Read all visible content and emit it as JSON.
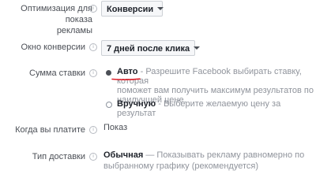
{
  "ad_delivery": {
    "label": "Оптимизация для показа рекламы",
    "label_line1": "Оптимизация для показа",
    "label_line2": "рекламы",
    "value": "Конверсии"
  },
  "conversion_window": {
    "label": "Окно конверсии",
    "value": "7 дней после клика"
  },
  "bid_amount": {
    "label": "Сумма ставки",
    "auto": {
      "label": "Авто",
      "description": "- Разрешите Facebook выбирать ставку, которая поможет вам получить максимум результатов по наилучшей цене.",
      "line1": "- Разрешите Facebook выбирать ставку, которая",
      "line2": "поможет вам получить максимум результатов по",
      "line3": "наилучшей цене.",
      "selected": true
    },
    "manual": {
      "label": "Вручную",
      "description": "- Выберите желаемую цену за результат",
      "selected": false
    }
  },
  "when_charged": {
    "label": "Когда вы платите",
    "value": "Показ"
  },
  "delivery_type": {
    "label": "Тип доставки",
    "value": "Обычная",
    "description": "— Показывать рекламу равномерно по выбранному графику (рекомендуется)",
    "line1": "— Показывать рекламу равномерно по",
    "line2": "выбранному графику (рекомендуется)"
  },
  "colors": {
    "annotation_underline": "#e0202a",
    "text": "#4b4f56",
    "muted": "#90949c"
  },
  "icons": {
    "info": "info-icon",
    "dropdown": "chevron-down-icon"
  }
}
